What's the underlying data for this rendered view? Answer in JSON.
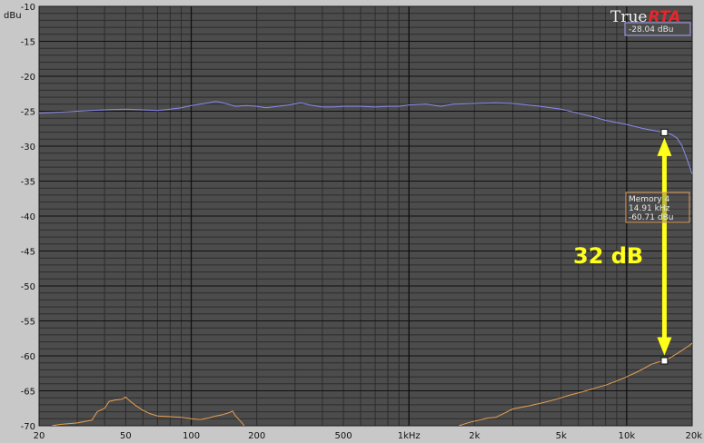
{
  "chart_data": {
    "type": "line",
    "title": "",
    "ylabel": "dBu",
    "xlabel": "",
    "x_scale": "log",
    "xlim": [
      20,
      20000
    ],
    "ylim": [
      -70,
      -10
    ],
    "grid": true,
    "x_ticks": [
      {
        "value": 20,
        "label": "20"
      },
      {
        "value": 50,
        "label": "50"
      },
      {
        "value": 100,
        "label": "100"
      },
      {
        "value": 200,
        "label": "200"
      },
      {
        "value": 500,
        "label": "500"
      },
      {
        "value": 1000,
        "label": "1kHz"
      },
      {
        "value": 2000,
        "label": "2k"
      },
      {
        "value": 5000,
        "label": "5k"
      },
      {
        "value": 10000,
        "label": "10k"
      },
      {
        "value": 20000,
        "label": "20k"
      }
    ],
    "y_ticks": [
      -10,
      -15,
      -20,
      -25,
      -30,
      -35,
      -40,
      -45,
      -50,
      -55,
      -60,
      -65,
      -70
    ],
    "series": [
      {
        "color": "#8a8cf2",
        "points": [
          [
            20,
            -25.3
          ],
          [
            30,
            -25.0
          ],
          [
            40,
            -24.8
          ],
          [
            50,
            -24.7
          ],
          [
            60,
            -24.8
          ],
          [
            70,
            -24.9
          ],
          [
            80,
            -24.7
          ],
          [
            90,
            -24.5
          ],
          [
            100,
            -24.2
          ],
          [
            110,
            -24.0
          ],
          [
            120,
            -23.8
          ],
          [
            130,
            -23.6
          ],
          [
            140,
            -23.8
          ],
          [
            160,
            -24.3
          ],
          [
            180,
            -24.2
          ],
          [
            200,
            -24.3
          ],
          [
            220,
            -24.5
          ],
          [
            250,
            -24.3
          ],
          [
            280,
            -24.1
          ],
          [
            320,
            -23.8
          ],
          [
            350,
            -24.1
          ],
          [
            400,
            -24.4
          ],
          [
            450,
            -24.4
          ],
          [
            500,
            -24.3
          ],
          [
            600,
            -24.3
          ],
          [
            700,
            -24.4
          ],
          [
            800,
            -24.3
          ],
          [
            900,
            -24.3
          ],
          [
            1000,
            -24.1
          ],
          [
            1200,
            -24.0
          ],
          [
            1400,
            -24.3
          ],
          [
            1600,
            -24.0
          ],
          [
            2000,
            -23.9
          ],
          [
            2500,
            -23.8
          ],
          [
            3000,
            -23.9
          ],
          [
            3500,
            -24.1
          ],
          [
            4000,
            -24.3
          ],
          [
            5000,
            -24.7
          ],
          [
            6000,
            -25.3
          ],
          [
            7000,
            -25.8
          ],
          [
            8000,
            -26.3
          ],
          [
            10000,
            -26.9
          ],
          [
            12000,
            -27.5
          ],
          [
            14000,
            -27.9
          ],
          [
            14910,
            -28.04
          ],
          [
            16000,
            -28.3
          ],
          [
            17000,
            -28.8
          ],
          [
            18000,
            -30.0
          ],
          [
            19000,
            -32.0
          ],
          [
            20000,
            -34.0
          ]
        ]
      },
      {
        "color": "#e8a052",
        "segments": [
          [
            [
              23,
              -70.0
            ],
            [
              25,
              -69.8
            ],
            [
              30,
              -69.6
            ],
            [
              35,
              -69.2
            ],
            [
              37,
              -68.0
            ],
            [
              40,
              -67.5
            ],
            [
              42,
              -66.5
            ],
            [
              45,
              -66.3
            ],
            [
              48,
              -66.2
            ],
            [
              50,
              -65.9
            ],
            [
              52,
              -66.4
            ],
            [
              55,
              -67.0
            ],
            [
              60,
              -67.8
            ],
            [
              65,
              -68.3
            ],
            [
              70,
              -68.6
            ],
            [
              80,
              -68.7
            ],
            [
              90,
              -68.8
            ],
            [
              100,
              -69.0
            ],
            [
              110,
              -69.1
            ],
            [
              120,
              -68.9
            ],
            [
              130,
              -68.6
            ],
            [
              140,
              -68.4
            ],
            [
              150,
              -68.1
            ],
            [
              155,
              -67.9
            ],
            [
              160,
              -68.6
            ],
            [
              170,
              -69.5
            ],
            [
              175,
              -70.0
            ]
          ],
          [
            [
              1700,
              -70.0
            ],
            [
              1900,
              -69.5
            ],
            [
              2100,
              -69.2
            ],
            [
              2300,
              -68.9
            ],
            [
              2500,
              -68.8
            ],
            [
              2700,
              -68.3
            ],
            [
              3000,
              -67.6
            ],
            [
              3500,
              -67.2
            ],
            [
              4000,
              -66.8
            ],
            [
              4500,
              -66.4
            ],
            [
              5000,
              -66.0
            ],
            [
              5500,
              -65.6
            ],
            [
              6000,
              -65.3
            ],
            [
              6500,
              -65.0
            ],
            [
              7000,
              -64.7
            ],
            [
              8000,
              -64.2
            ],
            [
              9000,
              -63.6
            ],
            [
              10000,
              -63.0
            ],
            [
              11000,
              -62.4
            ],
            [
              12000,
              -61.8
            ],
            [
              13000,
              -61.2
            ],
            [
              14000,
              -60.9
            ],
            [
              14910,
              -60.71
            ],
            [
              16000,
              -60.2
            ],
            [
              17000,
              -59.7
            ],
            [
              18000,
              -59.2
            ],
            [
              19000,
              -58.7
            ],
            [
              20000,
              -58.2
            ]
          ]
        ]
      }
    ],
    "markers": [
      {
        "x": 14910,
        "y": -28.04
      },
      {
        "x": 14910,
        "y": -60.71
      }
    ],
    "readout": "-28.04 dBu",
    "tooltip": [
      "Memory 4",
      "14.91 kHz",
      "-60.71 dBu"
    ],
    "annotation": "32 dB"
  },
  "logo": {
    "prefix": "True",
    "suffix": "RTA"
  },
  "colors": {
    "plot_bg": "#4c4c4c",
    "frame_bg": "#c8c8c8",
    "major_grid": "#101010",
    "minor_grid": "#2c2c2c",
    "arrow": "#ffff1a"
  }
}
